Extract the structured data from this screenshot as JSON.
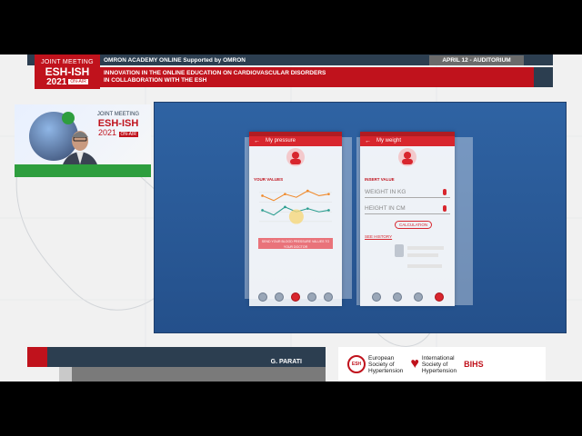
{
  "event": {
    "logo_line1": "JOINT MEETING",
    "logo_line2": "ESH-ISH",
    "logo_year": "2021",
    "logo_onair": "ON-AIR",
    "session_line": "OMRON ACADEMY ONLINE Supported by OMRON",
    "date_room": "APRIL 12 - AUDITORIUM",
    "title_line1": "INNOVATION IN THE ONLINE EDUCATION ON CARDIOVASCULAR DISORDERS",
    "title_line2": "IN COLLABORATION WITH THE ESH"
  },
  "webcam": {
    "logo_line1": "JOINT MEETING",
    "logo_line2": "ESH-ISH",
    "logo_year": "2021",
    "logo_onair": "ON-AIR"
  },
  "slide": {
    "phone1": {
      "title": "My pressure",
      "section": "YOUR VALUES",
      "button": "SEND YOUR BLOOD PRESSURE VALUES TO YOUR DOCTOR"
    },
    "phone2": {
      "title": "My weight",
      "section": "INSERT VALUE",
      "field1": "WEIGHT IN KG",
      "field2": "HEIGHT IN CM",
      "calc_button": "CALCULATION",
      "history_link": "SEE HISTORY"
    }
  },
  "lower_third": {
    "speaker": "G. PARATI"
  },
  "partners": {
    "esh_logo": "ESH",
    "esh_name_line1": "European",
    "esh_name_line2": "Society of",
    "esh_name_line3": "Hypertension",
    "ish_name_line1": "International",
    "ish_name_line2": "Society of",
    "ish_name_line3": "Hypertension",
    "bihs_label": "BIHS"
  },
  "colors": {
    "brand_red": "#c0121c",
    "brand_navy": "#2c3e50",
    "slide_blue": "#2f63a3"
  }
}
